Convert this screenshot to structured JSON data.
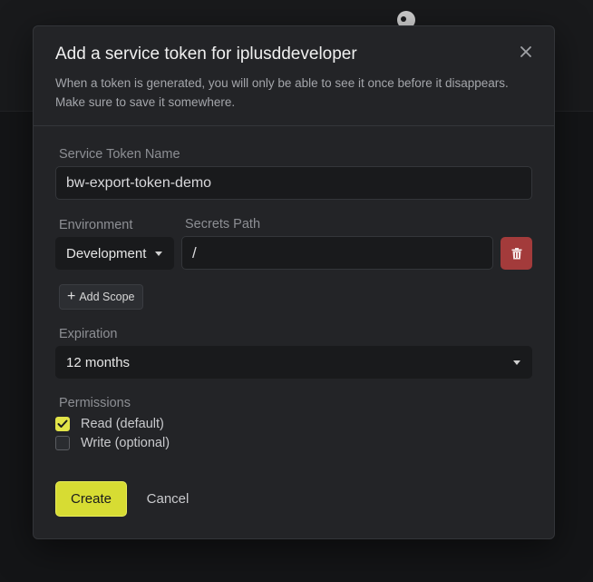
{
  "modal": {
    "title": "Add a service token for iplusddeveloper",
    "description": "When a token is generated, you will only be able to see it once before it disappears. Make sure to save it somewhere.",
    "close_icon": "close-icon"
  },
  "token_name": {
    "label": "Service Token Name",
    "value": "bw-export-token-demo"
  },
  "scope": {
    "environment_label": "Environment",
    "environment_value": "Development",
    "secrets_path_label": "Secrets Path",
    "secrets_path_value": "/",
    "delete_icon": "trash-icon",
    "delete_color": "#a33b3b",
    "add_scope_label": "Add Scope"
  },
  "expiration": {
    "label": "Expiration",
    "value": "12 months"
  },
  "permissions": {
    "label": "Permissions",
    "options": [
      {
        "label": "Read (default)",
        "checked": true
      },
      {
        "label": "Write (optional)",
        "checked": false
      }
    ]
  },
  "actions": {
    "create_label": "Create",
    "cancel_label": "Cancel",
    "accent_color": "#d7dc33"
  }
}
